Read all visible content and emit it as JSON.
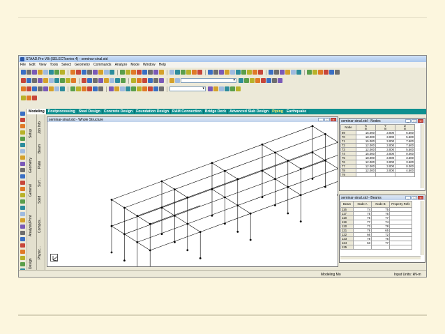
{
  "app": {
    "title": "STAAD.Pro V8i (SELECTseries 4) - seminar-sinal.std",
    "menu": [
      "File",
      "Edit",
      "View",
      "Tools",
      "Select",
      "Geometry",
      "Commands",
      "Analyze",
      "Mode",
      "Window",
      "Help"
    ]
  },
  "toolbar": {
    "combo_row2_value": "",
    "combo_row3_value": ""
  },
  "tabs": [
    {
      "label": "Modeling",
      "state": "active"
    },
    {
      "label": "Postprocessing",
      "state": "normal"
    },
    {
      "label": "Steel Design",
      "state": "normal"
    },
    {
      "label": "Concrete Design",
      "state": "normal"
    },
    {
      "label": "Foundation Design",
      "state": "normal"
    },
    {
      "label": "RAM Connection",
      "state": "normal"
    },
    {
      "label": "Bridge Deck",
      "state": "normal"
    },
    {
      "label": "Advanced Slab Design",
      "state": "normal"
    },
    {
      "label": "Piping",
      "state": "highlight"
    },
    {
      "label": "Earthquake",
      "state": "normal"
    }
  ],
  "page_control": {
    "outer": [
      "Setup",
      "Geometry",
      "General",
      "Analysis/Print",
      "Design"
    ],
    "inner": [
      "Job Info",
      "Beam",
      "Plate",
      "Surf...",
      "Solid",
      "Physic...",
      "Compos..."
    ]
  },
  "structure_window": {
    "title": "seminar-sinal.std - Whole Structure"
  },
  "nodes_window": {
    "title": "seminar-sinal.std - Nodes",
    "columns": [
      "Node",
      "X\nm",
      "Y\nm",
      "Z\nm"
    ],
    "rows": [
      [
        "69",
        "15.000",
        "3.000",
        "6.500"
      ],
      [
        "70",
        "18.000",
        "3.000",
        "5.500"
      ],
      [
        "71",
        "15.000",
        "3.000",
        "7.500"
      ],
      [
        "72",
        "12.000",
        "3.000",
        "7.500"
      ],
      [
        "73",
        "12.000",
        "3.000",
        "5.500"
      ],
      [
        "74",
        "15.000",
        "3.000",
        "0.000"
      ],
      [
        "75",
        "18.000",
        "3.000",
        "3.500"
      ],
      [
        "76",
        "12.000",
        "3.000",
        "3.500"
      ],
      [
        "77",
        "12.000",
        "3.000",
        "0.000"
      ],
      [
        "78",
        "12.000",
        "3.000",
        "4.500"
      ],
      [
        "79",
        "",
        "",
        " "
      ]
    ]
  },
  "beams_window": {
    "title": "seminar-sinal.std - Beams",
    "columns": [
      "Beam",
      "Node A",
      "Node B",
      "Property Refe"
    ],
    "rows": [
      [
        "116",
        "74",
        "75",
        ""
      ],
      [
        "117",
        "75",
        "76",
        ""
      ],
      [
        "118",
        "76",
        "77",
        ""
      ],
      [
        "119",
        "77",
        "74",
        ""
      ],
      [
        "120",
        "73",
        "78",
        ""
      ],
      [
        "121",
        "78",
        "65",
        ""
      ],
      [
        "122",
        "66",
        "72",
        ""
      ],
      [
        "123",
        "78",
        "76",
        ""
      ],
      [
        "124",
        "63",
        "77",
        ""
      ],
      [
        "125",
        "",
        "",
        ""
      ]
    ]
  },
  "status": {
    "mode": "Modeling Mo",
    "units": "Input Units:  kN-m"
  },
  "colors": {
    "tab_strip": "#0e8f8f",
    "highlight_tab": "#ffef6e",
    "title_bar": "#aac7ee"
  }
}
